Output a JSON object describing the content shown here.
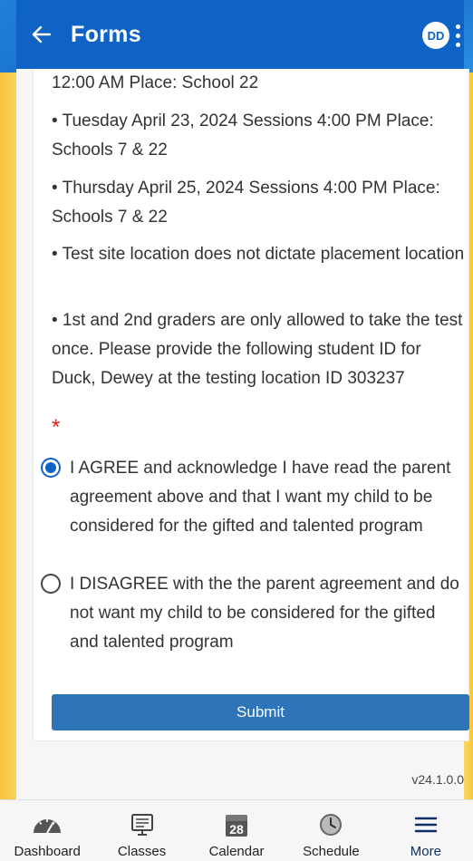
{
  "header": {
    "title": "Forms",
    "avatar_initials": "DD",
    "back_icon": "arrow-left-icon",
    "menu_icon": "kebab-menu-icon"
  },
  "form": {
    "paragraphs": [
      "12:00 AM Place: School 22",
      "• Tuesday April 23, 2024 Sessions 4:00 PM Place: Schools 7 & 22",
      "• Thursday April 25, 2024 Sessions 4:00 PM Place: Schools 7 & 22",
      "• Test site location does not dictate placement location",
      "• 1st and 2nd graders are only allowed to take the test once. Please provide the following student ID for Duck, Dewey at the testing location ID 303237"
    ],
    "required_marker": "*",
    "options": [
      {
        "label": "I AGREE and acknowledge I have read the parent agreement above and that I want my child to be considered for the gifted and talented program",
        "selected": true
      },
      {
        "label": "I DISAGREE with the the parent agreement and do not want my child to be considered for the gifted and talented program",
        "selected": false
      }
    ],
    "submit_label": "Submit"
  },
  "version": "v24.1.0.0",
  "bottom_nav": {
    "items": [
      {
        "label": "Dashboard",
        "icon": "speedometer-icon"
      },
      {
        "label": "Classes",
        "icon": "monitor-icon"
      },
      {
        "label": "Calendar",
        "icon": "calendar-icon",
        "badge": "28"
      },
      {
        "label": "Schedule",
        "icon": "clock-icon"
      },
      {
        "label": "More",
        "icon": "hamburger-icon",
        "active": true
      }
    ]
  },
  "colors": {
    "primary": "#0e63c4",
    "button": "#2d74b8",
    "required": "#e02020",
    "side_gradient": "#f7c53c"
  }
}
